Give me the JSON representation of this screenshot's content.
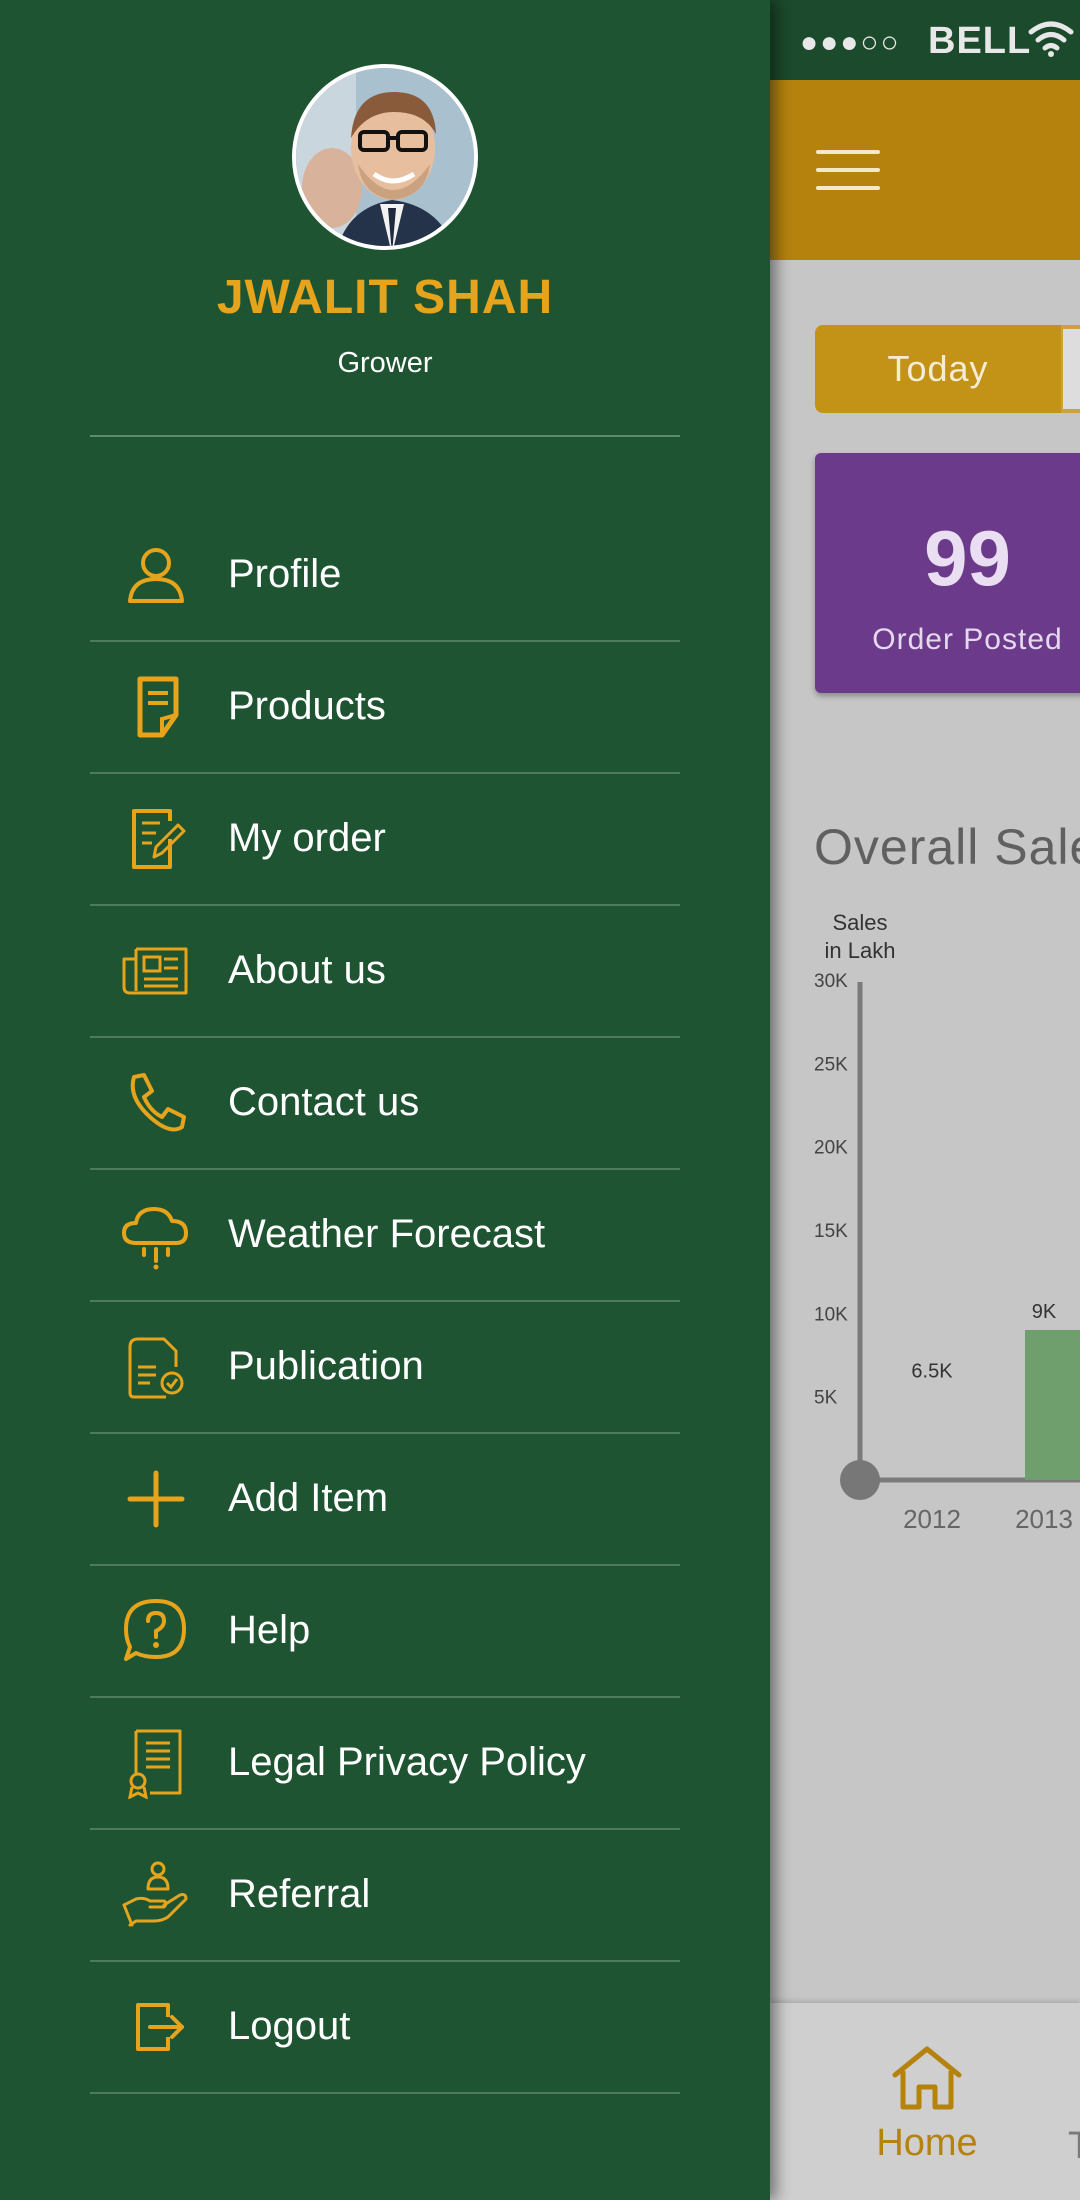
{
  "status_bar": {
    "signal": "●●●○○",
    "carrier": "BELL"
  },
  "drawer": {
    "user": {
      "name": "JWALIT SHAH",
      "role": "Grower"
    },
    "items": [
      {
        "label": "Profile",
        "icon": "person-icon"
      },
      {
        "label": "Products",
        "icon": "product-note-icon"
      },
      {
        "label": "My order",
        "icon": "order-edit-icon"
      },
      {
        "label": "About us",
        "icon": "newspaper-icon"
      },
      {
        "label": "Contact us",
        "icon": "phone-icon"
      },
      {
        "label": "Weather Forecast",
        "icon": "cloud-rain-icon"
      },
      {
        "label": "Publication",
        "icon": "document-check-icon"
      },
      {
        "label": "Add Item",
        "icon": "plus-icon"
      },
      {
        "label": "Help",
        "icon": "help-bubble-icon"
      },
      {
        "label": "Legal Privacy Policy",
        "icon": "certificate-icon"
      },
      {
        "label": "Referral",
        "icon": "hand-person-icon"
      },
      {
        "label": "Logout",
        "icon": "logout-icon"
      }
    ]
  },
  "dashboard": {
    "period_toggle": {
      "selected": "Today"
    },
    "stat_card": {
      "value": "99",
      "label": "Order Posted"
    },
    "section_title": "Overall Sales"
  },
  "chart_data": {
    "type": "bar",
    "ylabel": "Sales\nin Lakh",
    "ylabel_lines": [
      "Sales",
      "in Lakh"
    ],
    "yticks": [
      "30K",
      "25K",
      "20K",
      "15K",
      "10K",
      "5K"
    ],
    "ylim": [
      0,
      30000
    ],
    "categories": [
      "2012",
      "2013"
    ],
    "values": [
      6500,
      9000
    ],
    "data_labels": [
      "6.5K",
      "9K"
    ],
    "bar_color": "#6f9f6c"
  },
  "bottom_nav": {
    "home_label": "Home",
    "next_label_partial": "T"
  },
  "colors": {
    "drawer_bg": "#1f5433",
    "accent_gold": "#e6a41c",
    "appbar": "#b5820e",
    "stat_card": "#6b3a8a"
  }
}
